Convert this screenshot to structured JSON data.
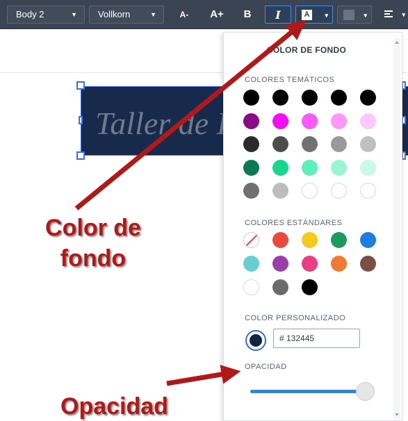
{
  "toolbar": {
    "style_select": "Body 2",
    "font_select": "Vollkorn",
    "decrease_font": "A-",
    "increase_font": "A+",
    "bold": "B",
    "italic": "I",
    "bg_color_icon_letter": "A",
    "dropdown_caret": "▾"
  },
  "canvas": {
    "textbox_text": "Taller de I",
    "textbox_bg_color": "#172a4b"
  },
  "panel": {
    "title": "COLOR DE FONDO",
    "theme_label": "COLORES TEMÁTICOS",
    "theme_colors": [
      [
        "#000000",
        "#000000",
        "#000000",
        "#000000",
        "#000000"
      ],
      [
        "#8a0a8a",
        "#f20ef2",
        "#fb5bfb",
        "#fc98fc",
        "#fec7fe"
      ],
      [
        "#2b2b2b",
        "#4d4d4d",
        "#727272",
        "#9a9a9a",
        "#c0c0c0"
      ],
      [
        "#0b7a53",
        "#18d68c",
        "#5ef0bb",
        "#9af5d4",
        "#cbf9e7"
      ],
      [
        "#707070",
        "#bdbdbd",
        "#ffffff",
        "#ffffff",
        "#ffffff"
      ]
    ],
    "standard_label": "COLORES ESTÁNDARES",
    "standard_colors": [
      [
        "none",
        "#e84a3f",
        "#f2cb1d",
        "#1f9a5b",
        "#1e7de0"
      ],
      [
        "#67cfcf",
        "#9b3fa8",
        "#e83f80",
        "#f07a32",
        "#7b4f45"
      ],
      [
        "#ffffff",
        "#6b6b6b",
        "#000000"
      ]
    ],
    "custom_label": "COLOR PERSONALIZADO",
    "custom_color": "#132445",
    "custom_hex": "# 132445",
    "opacity_label": "OPACIDAD",
    "opacity_value": 1.0
  },
  "annotations": {
    "color_de_fondo_line1": "Color de",
    "color_de_fondo_line2": "fondo",
    "opacidad": "Opacidad",
    "arrow_color": "#b11818"
  }
}
